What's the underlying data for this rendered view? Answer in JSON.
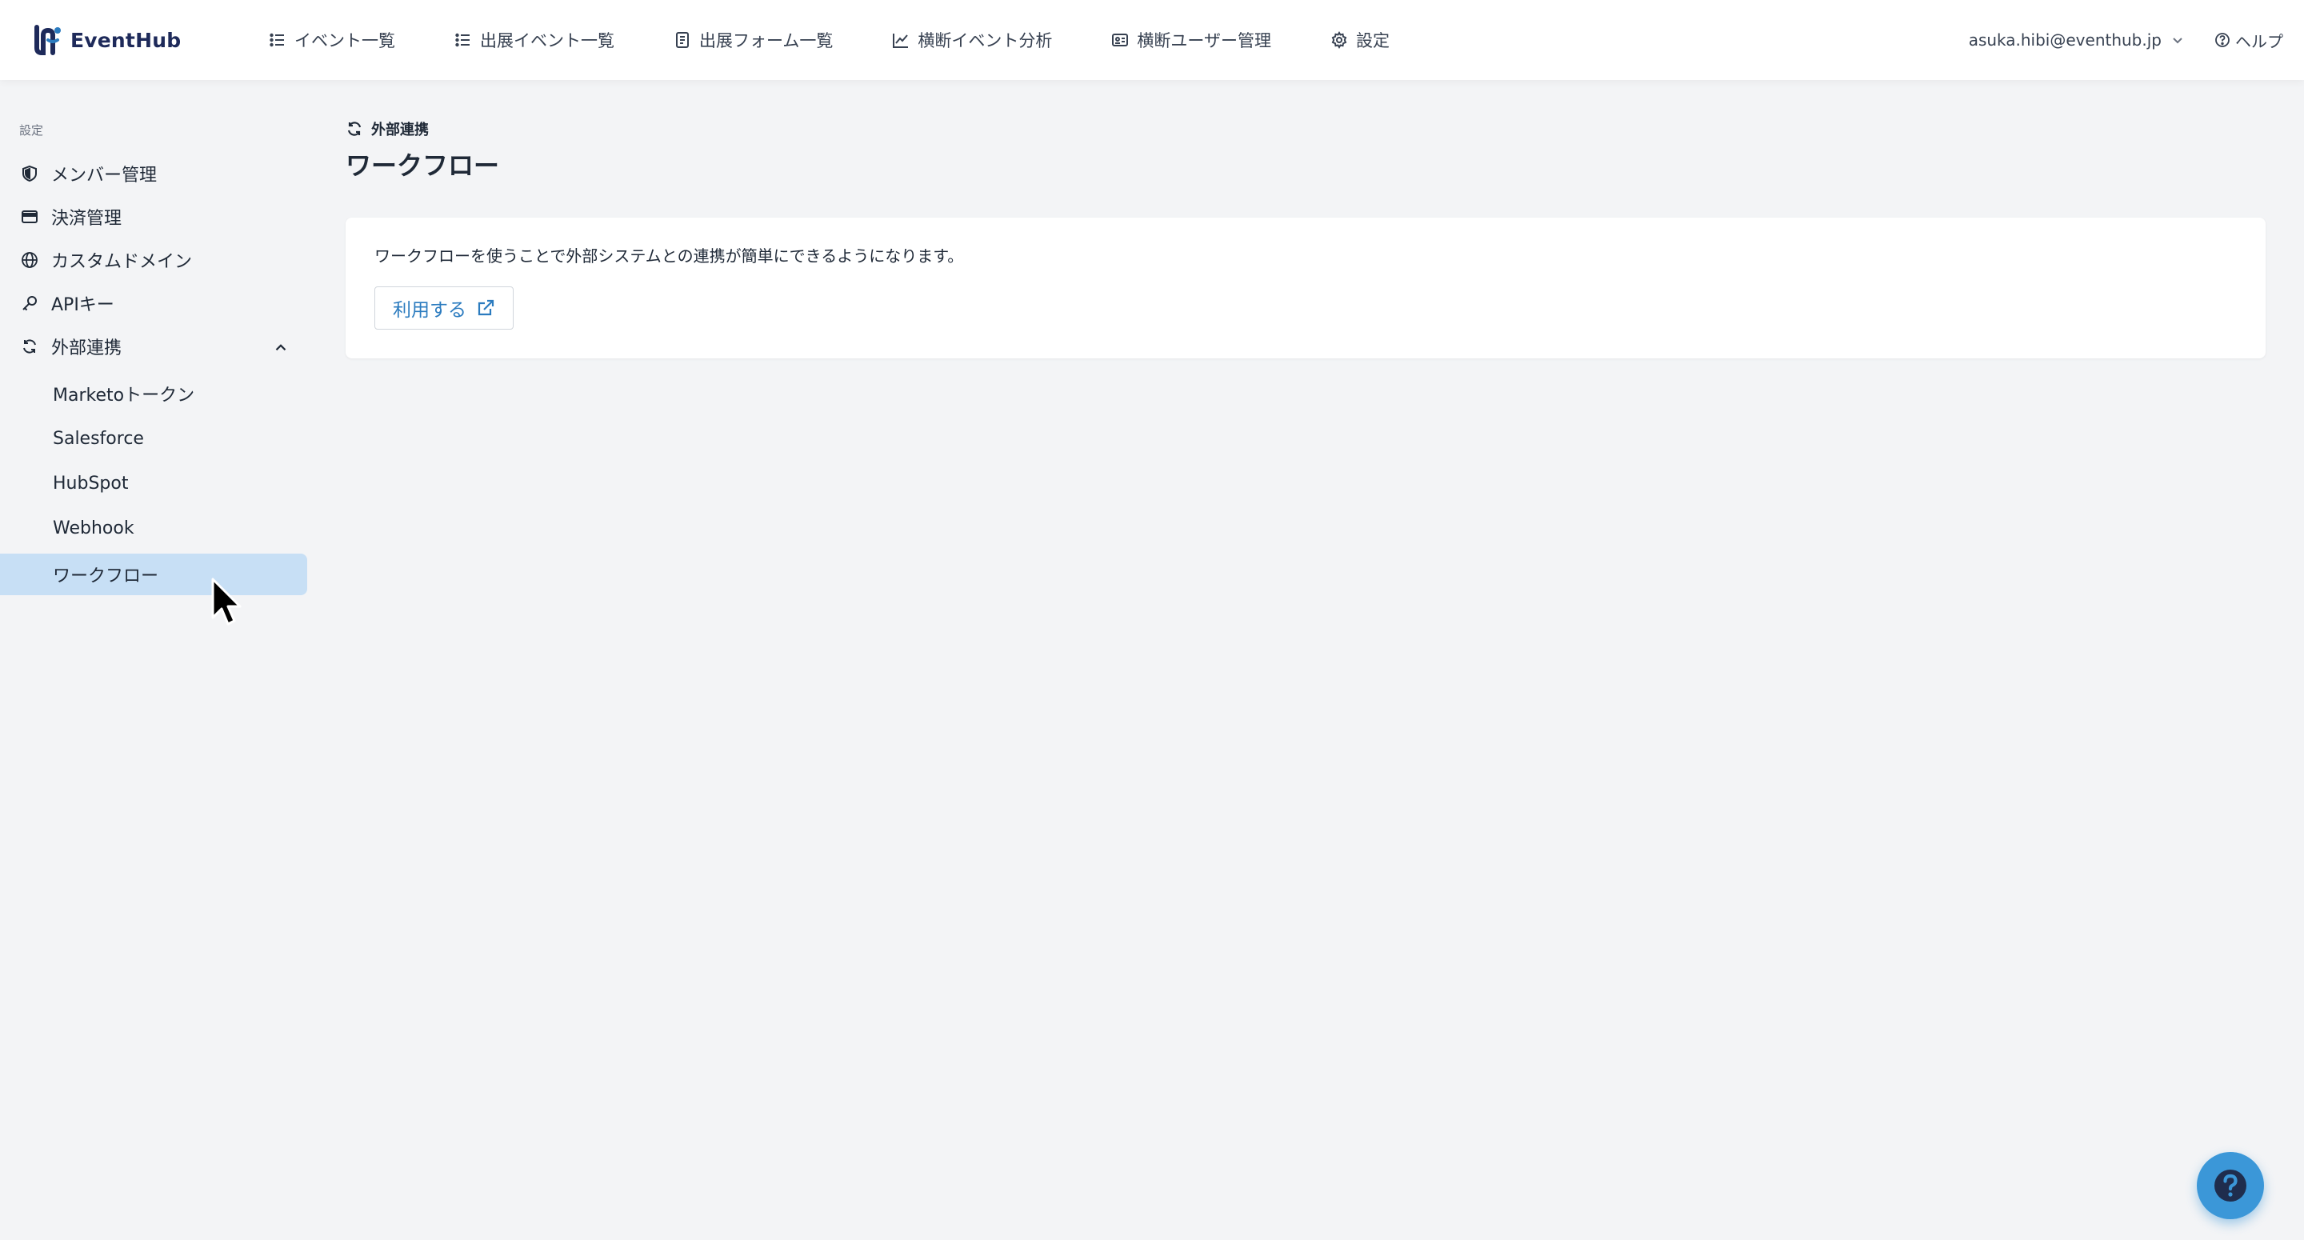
{
  "app": {
    "brand": "EventHub"
  },
  "nav": {
    "items": [
      {
        "label": "イベント一覧",
        "icon": "list-icon"
      },
      {
        "label": "出展イベント一覧",
        "icon": "list-icon"
      },
      {
        "label": "出展フォーム一覧",
        "icon": "form-icon"
      },
      {
        "label": "横断イベント分析",
        "icon": "chart-line-icon"
      },
      {
        "label": "横断ユーザー管理",
        "icon": "id-card-icon"
      },
      {
        "label": "設定",
        "icon": "gear-icon"
      }
    ]
  },
  "user": {
    "email": "asuka.hibi@eventhub.jp",
    "help_label": "ヘルプ"
  },
  "sidebar": {
    "section_label": "設定",
    "items": [
      {
        "label": "メンバー管理",
        "icon": "shield-icon"
      },
      {
        "label": "決済管理",
        "icon": "credit-card-icon"
      },
      {
        "label": "カスタムドメイン",
        "icon": "globe-icon"
      },
      {
        "label": "APIキー",
        "icon": "key-icon"
      },
      {
        "label": "外部連携",
        "icon": "sync-icon"
      }
    ],
    "sub_items": [
      {
        "label": "Marketoトークン"
      },
      {
        "label": "Salesforce"
      },
      {
        "label": "HubSpot"
      },
      {
        "label": "Webhook"
      },
      {
        "label": "ワークフロー",
        "active": true
      }
    ]
  },
  "main": {
    "breadcrumb": "外部連携",
    "title": "ワークフロー",
    "description": "ワークフローを使うことで外部システムとの連携が簡単にできるようになります。",
    "use_button_label": "利用する"
  },
  "colors": {
    "accent": "#2b7bbf",
    "active_bg": "#c7dff5",
    "fab": "#3b97d8",
    "brand": "#1e2a5a"
  }
}
